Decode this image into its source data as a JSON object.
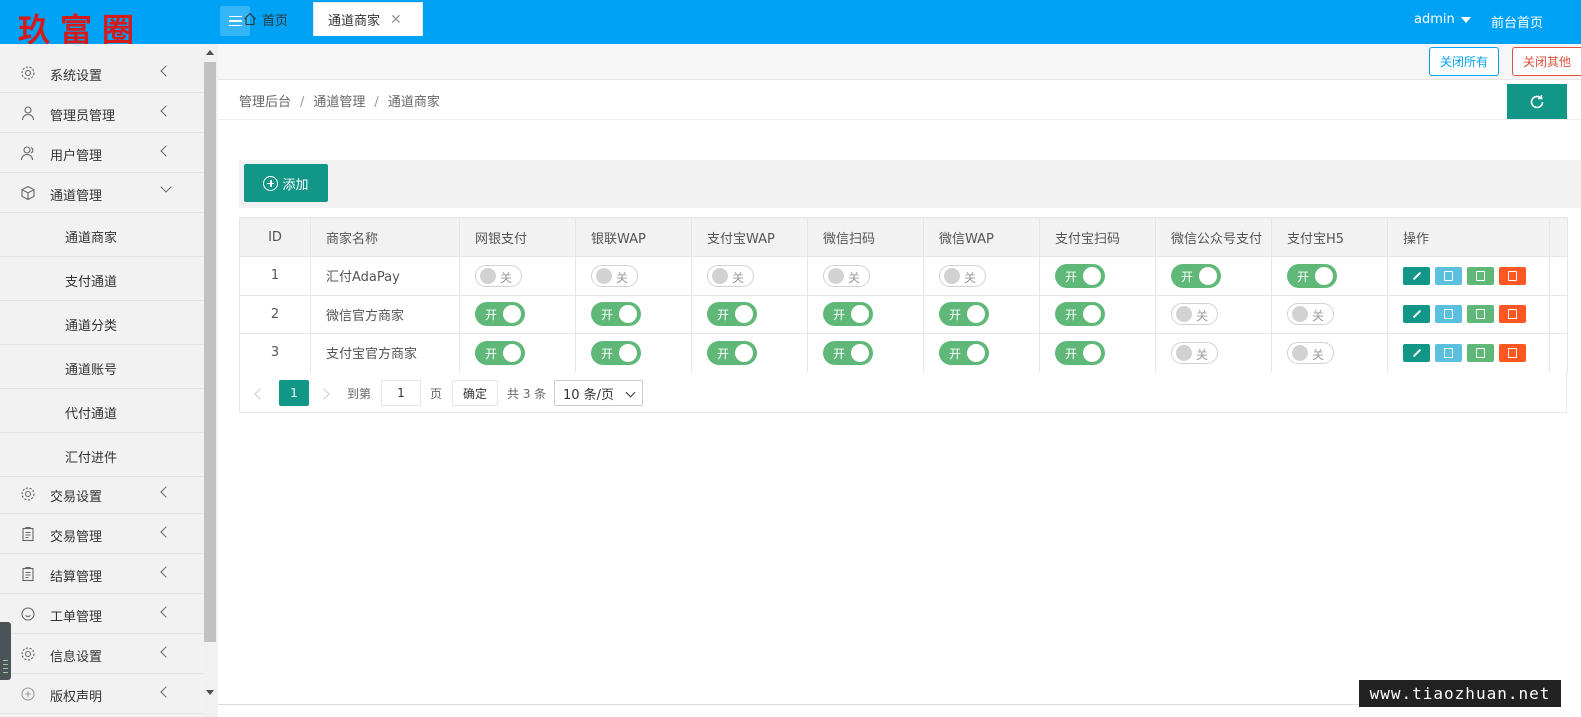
{
  "header": {
    "logo_text": "玖富圈",
    "user": "admin",
    "front_link": "前台首页"
  },
  "sidebar": {
    "items": [
      {
        "label": "系统设置",
        "icon": "gear-icon"
      },
      {
        "label": "管理员管理",
        "icon": "user-icon"
      },
      {
        "label": "用户管理",
        "icon": "users-icon"
      },
      {
        "label": "通道管理",
        "icon": "cube-icon",
        "expanded": true
      },
      {
        "label": "交易设置",
        "icon": "gear-icon"
      },
      {
        "label": "交易管理",
        "icon": "clipboard-icon"
      },
      {
        "label": "结算管理",
        "icon": "clipboard-icon"
      },
      {
        "label": "工单管理",
        "icon": "smile-icon"
      },
      {
        "label": "信息设置",
        "icon": "gear-icon"
      },
      {
        "label": "版权声明",
        "icon": "plus-circle-icon"
      }
    ],
    "submenu": [
      "通道商家",
      "支付通道",
      "通道分类",
      "通道账号",
      "代付通道",
      "汇付进件"
    ]
  },
  "tabs": [
    {
      "label": "首页"
    },
    {
      "label": "通道商家",
      "active": true
    }
  ],
  "tab_actions": {
    "close_all": "关闭所有",
    "close_other": "关闭其他"
  },
  "breadcrumb": [
    "管理后台",
    "通道管理",
    "通道商家"
  ],
  "toolbar": {
    "add_label": "添加"
  },
  "table": {
    "columns": [
      "ID",
      "商家名称",
      "网银支付",
      "银联WAP",
      "支付宝WAP",
      "微信扫码",
      "微信WAP",
      "支付宝扫码",
      "微信公众号支付",
      "支付宝H5",
      "操作"
    ],
    "switch_on": "开",
    "switch_off": "关",
    "rows": [
      {
        "id": "1",
        "name": "汇付AdaPay",
        "switches": [
          false,
          false,
          false,
          false,
          false,
          true,
          true,
          true
        ]
      },
      {
        "id": "2",
        "name": "微信官方商家",
        "switches": [
          true,
          true,
          true,
          true,
          true,
          true,
          false,
          false
        ]
      },
      {
        "id": "3",
        "name": "支付宝官方商家",
        "switches": [
          true,
          true,
          true,
          true,
          true,
          true,
          false,
          false
        ]
      }
    ]
  },
  "pagination": {
    "current": "1",
    "goto_label": "到第",
    "goto_value": "1",
    "page_label": "页",
    "confirm_label": "确定",
    "total": "共 3 条",
    "page_size": "10 条/页"
  },
  "watermark": "www.tiaozhuan.net",
  "colors": {
    "topbar": "#00a2f5",
    "primary": "#119688",
    "switch_on": "#5fb878",
    "danger": "#ff5722",
    "info": "#5bc0de"
  }
}
